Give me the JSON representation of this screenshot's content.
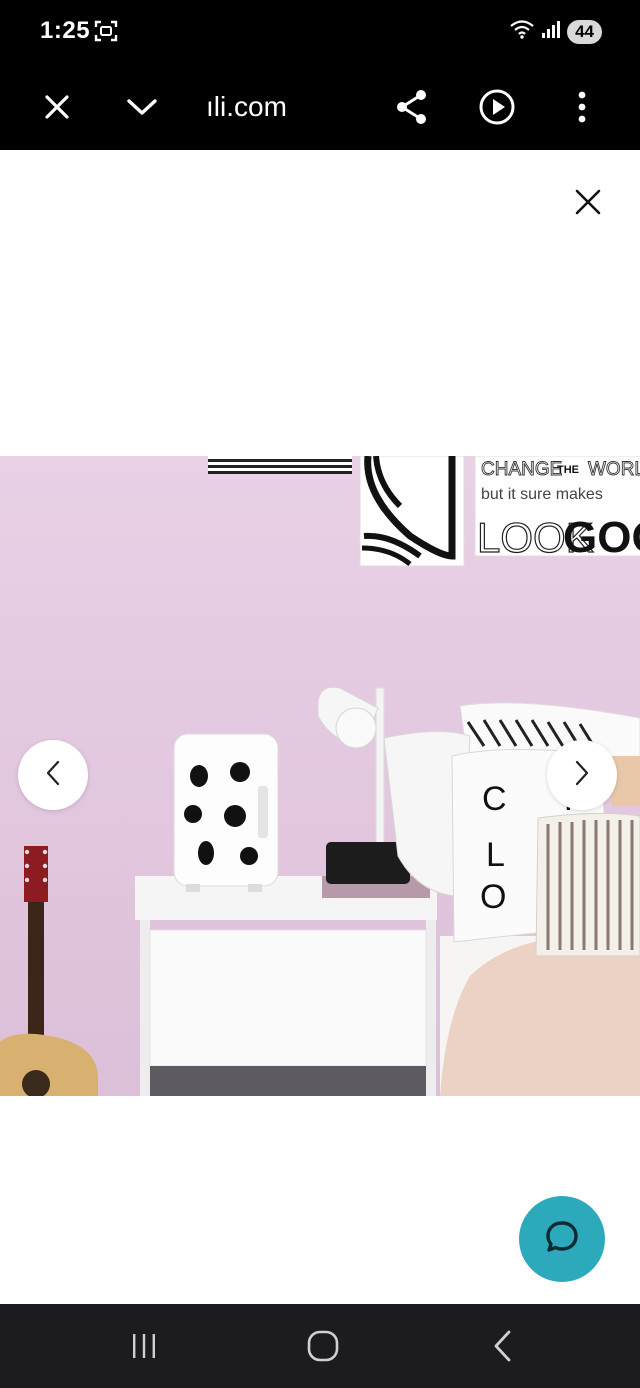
{
  "status_bar": {
    "time": "1:25",
    "battery_level": "44",
    "icons": [
      "screenshot-icon",
      "wifi-icon",
      "signal-icon",
      "battery-icon"
    ]
  },
  "toolbar": {
    "url": "ıli.com",
    "icons": [
      "close-icon",
      "chevron-down-icon",
      "share-icon",
      "play-icon",
      "more-vert-icon"
    ]
  },
  "viewer": {
    "icons": [
      "close-icon",
      "chevron-left-icon",
      "chevron-right-icon",
      "chat-icon"
    ],
    "accent_color": "#2ca9bb",
    "photo": {
      "wall_color": "#e7cfe4",
      "poster_text": [
        "CHANGE",
        "THE",
        "WORLD",
        "but it sure makes",
        "LOOK",
        "GOOD"
      ],
      "pillow_letters": [
        "C",
        "L",
        "O"
      ],
      "pillow_letter_partial": "F"
    }
  },
  "system_nav": {
    "icons": [
      "recents-icon",
      "home-icon",
      "back-icon"
    ]
  }
}
